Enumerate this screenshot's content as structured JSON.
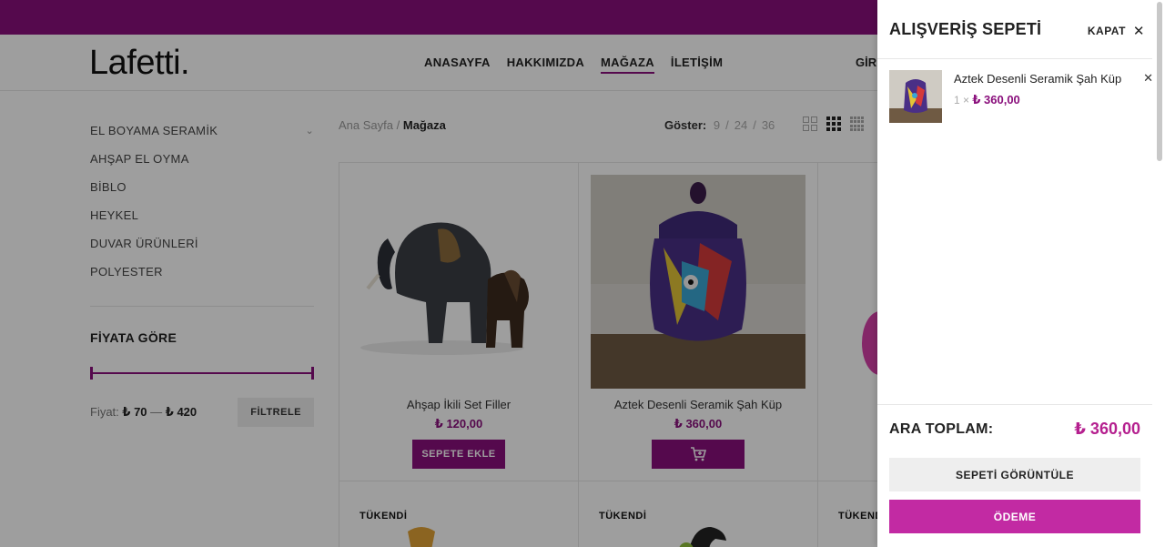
{
  "site": {
    "logo": "Lafetti."
  },
  "nav": {
    "items": [
      "ANASAYFA",
      "HAKKIMIZDA",
      "MAĞAZA",
      "İLETİŞİM"
    ],
    "login": "GİR"
  },
  "sidebar": {
    "categories": [
      "EL BOYAMA SERAMİK",
      "AHŞAP EL OYMA",
      "BİBLO",
      "HEYKEL",
      "DUVAR ÜRÜNLERİ",
      "POLYESTER"
    ],
    "price_filter": {
      "title": "FİYATA GÖRE",
      "label": "Fiyat:",
      "min": "₺ 70",
      "dash": "—",
      "max": "₺ 420",
      "button": "FİLTRELE"
    }
  },
  "breadcrumb": {
    "home": "Ana Sayfa",
    "sep": "/",
    "current": "Mağaza"
  },
  "show": {
    "label": "Göster:",
    "options": [
      "9",
      "24",
      "36"
    ]
  },
  "products": [
    {
      "name": "Ahşap İkili Set Filler",
      "price": "₺ 120,00",
      "button": "SEPETE EKLE"
    },
    {
      "name": "Aztek Desenli Seramik Şah Küp",
      "price": "₺ 360,00",
      "button": ""
    }
  ],
  "soldout_label": "TÜKENDİ",
  "cart": {
    "title": "ALIŞVERİŞ SEPETİ",
    "close": "KAPAT",
    "item": {
      "name": "Aztek Desenli Seramik Şah Küp",
      "qty": "1 ×",
      "price": "₺ 360,00"
    },
    "subtotal_label": "ARA TOPLAM:",
    "subtotal_value": "₺ 360,00",
    "view_cart": "SEPETİ GÖRÜNTÜLE",
    "checkout": "ÖDEME"
  },
  "colors": {
    "brand": "#8a0f7c",
    "accent": "#c22aa3"
  }
}
